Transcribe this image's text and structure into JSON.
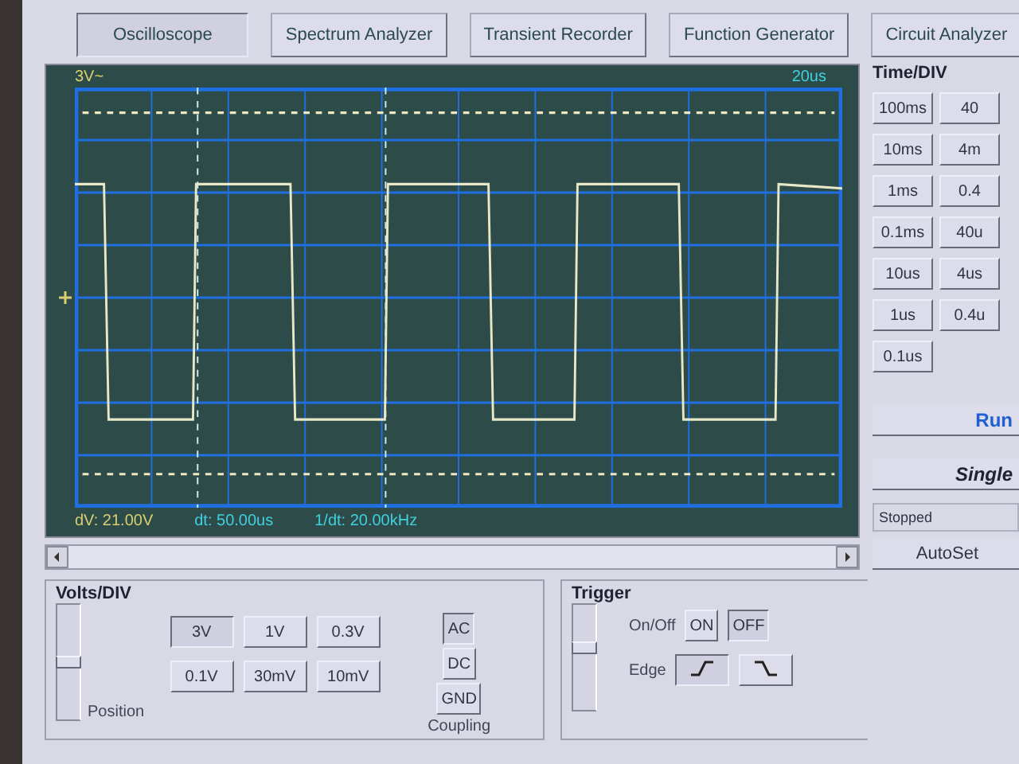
{
  "tabs": [
    {
      "label": "Oscilloscope",
      "selected": true
    },
    {
      "label": "Spectrum Analyzer",
      "selected": false
    },
    {
      "label": "Transient Recorder",
      "selected": false
    },
    {
      "label": "Function Generator",
      "selected": false
    },
    {
      "label": "Circuit Analyzer",
      "selected": false
    }
  ],
  "scope": {
    "volts_label": "3V~",
    "time_label": "20us",
    "dv": "dV: 21.00V",
    "dt": "dt: 50.00us",
    "freq": "1/dt: 20.00kHz"
  },
  "time_div": {
    "title": "Time/DIV",
    "buttons": [
      {
        "label": "100ms",
        "selected": false
      },
      {
        "label": "40",
        "selected": false
      },
      {
        "label": "10ms",
        "selected": false
      },
      {
        "label": "4m",
        "selected": false
      },
      {
        "label": "1ms",
        "selected": false
      },
      {
        "label": "0.4",
        "selected": false
      },
      {
        "label": "0.1ms",
        "selected": false
      },
      {
        "label": "40u",
        "selected": false
      },
      {
        "label": "10us",
        "selected": false
      },
      {
        "label": "4us",
        "selected": false
      },
      {
        "label": "1us",
        "selected": false
      },
      {
        "label": "0.4u",
        "selected": false
      },
      {
        "label": "0.1us",
        "selected": false
      }
    ]
  },
  "run": "Run",
  "single": "Single",
  "status": "Stopped",
  "autoset": "AutoSet",
  "volts_div": {
    "title": "Volts/DIV",
    "position": {
      "label": "Position",
      "level": 0.5
    },
    "buttons": [
      {
        "label": "3V",
        "selected": true
      },
      {
        "label": "1V",
        "selected": false
      },
      {
        "label": "0.3V",
        "selected": false
      },
      {
        "label": "0.1V",
        "selected": false
      },
      {
        "label": "30mV",
        "selected": false
      },
      {
        "label": "10mV",
        "selected": false
      }
    ],
    "coupling_label": "Coupling",
    "coupling": [
      {
        "label": "AC",
        "selected": true
      },
      {
        "label": "DC",
        "selected": false
      },
      {
        "label": "GND",
        "selected": false
      }
    ]
  },
  "trigger": {
    "title": "Trigger",
    "level": 0.6,
    "onoff_label": "On/Off",
    "onoff": [
      {
        "label": "ON",
        "selected": false
      },
      {
        "label": "OFF",
        "selected": true
      }
    ],
    "edge_label": "Edge",
    "edges": [
      {
        "kind": "rising",
        "selected": true
      },
      {
        "kind": "falling",
        "selected": false
      }
    ]
  }
}
